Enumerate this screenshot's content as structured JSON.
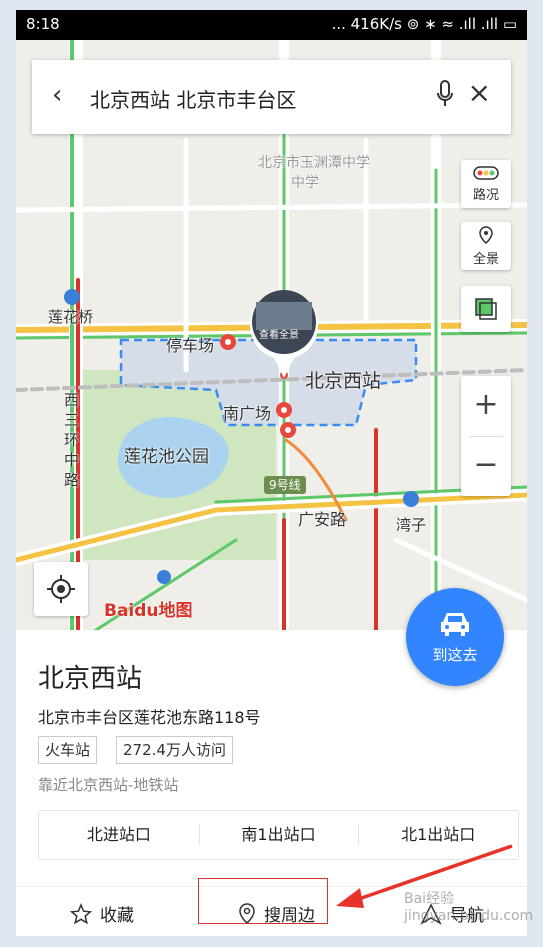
{
  "status_bar": {
    "time": "8:18",
    "right": "... 416K/s ⊚ ∗ ≈ .ıll .ıll ▭"
  },
  "search": {
    "query": "北京西站 北京市丰台区"
  },
  "map": {
    "tools": {
      "traffic": "路况",
      "panorama": "全景"
    },
    "labels": {
      "school": "北京市玉渊潭中学",
      "school_line2": "中学",
      "lianhuaqiao": "莲花桥",
      "parking": "停车场",
      "station": "北京西站",
      "south_square": "南广场",
      "park": "莲花池公园",
      "west_ring_road": "西三环中路",
      "line9": "9号线",
      "guanganlu": "广安路",
      "wanzi": "湾子",
      "view_panorama": "查看全景",
      "baidu_map": "Baidu地图"
    },
    "accent_color": "#3385ff"
  },
  "go_button": {
    "label": "到这去"
  },
  "place": {
    "name": "北京西站",
    "address": "北京市丰台区莲花池东路118号",
    "tags": [
      "火车站",
      "272.4万人访问"
    ],
    "nearby": "靠近北京西站-地铁站",
    "exits": [
      "北进站口",
      "南1出站口",
      "北1出站口"
    ]
  },
  "actions": {
    "favorite": "收藏",
    "search_nearby": "搜周边",
    "navigate": "导航"
  },
  "watermark": "Bai经验 jingyan.baidu.com"
}
